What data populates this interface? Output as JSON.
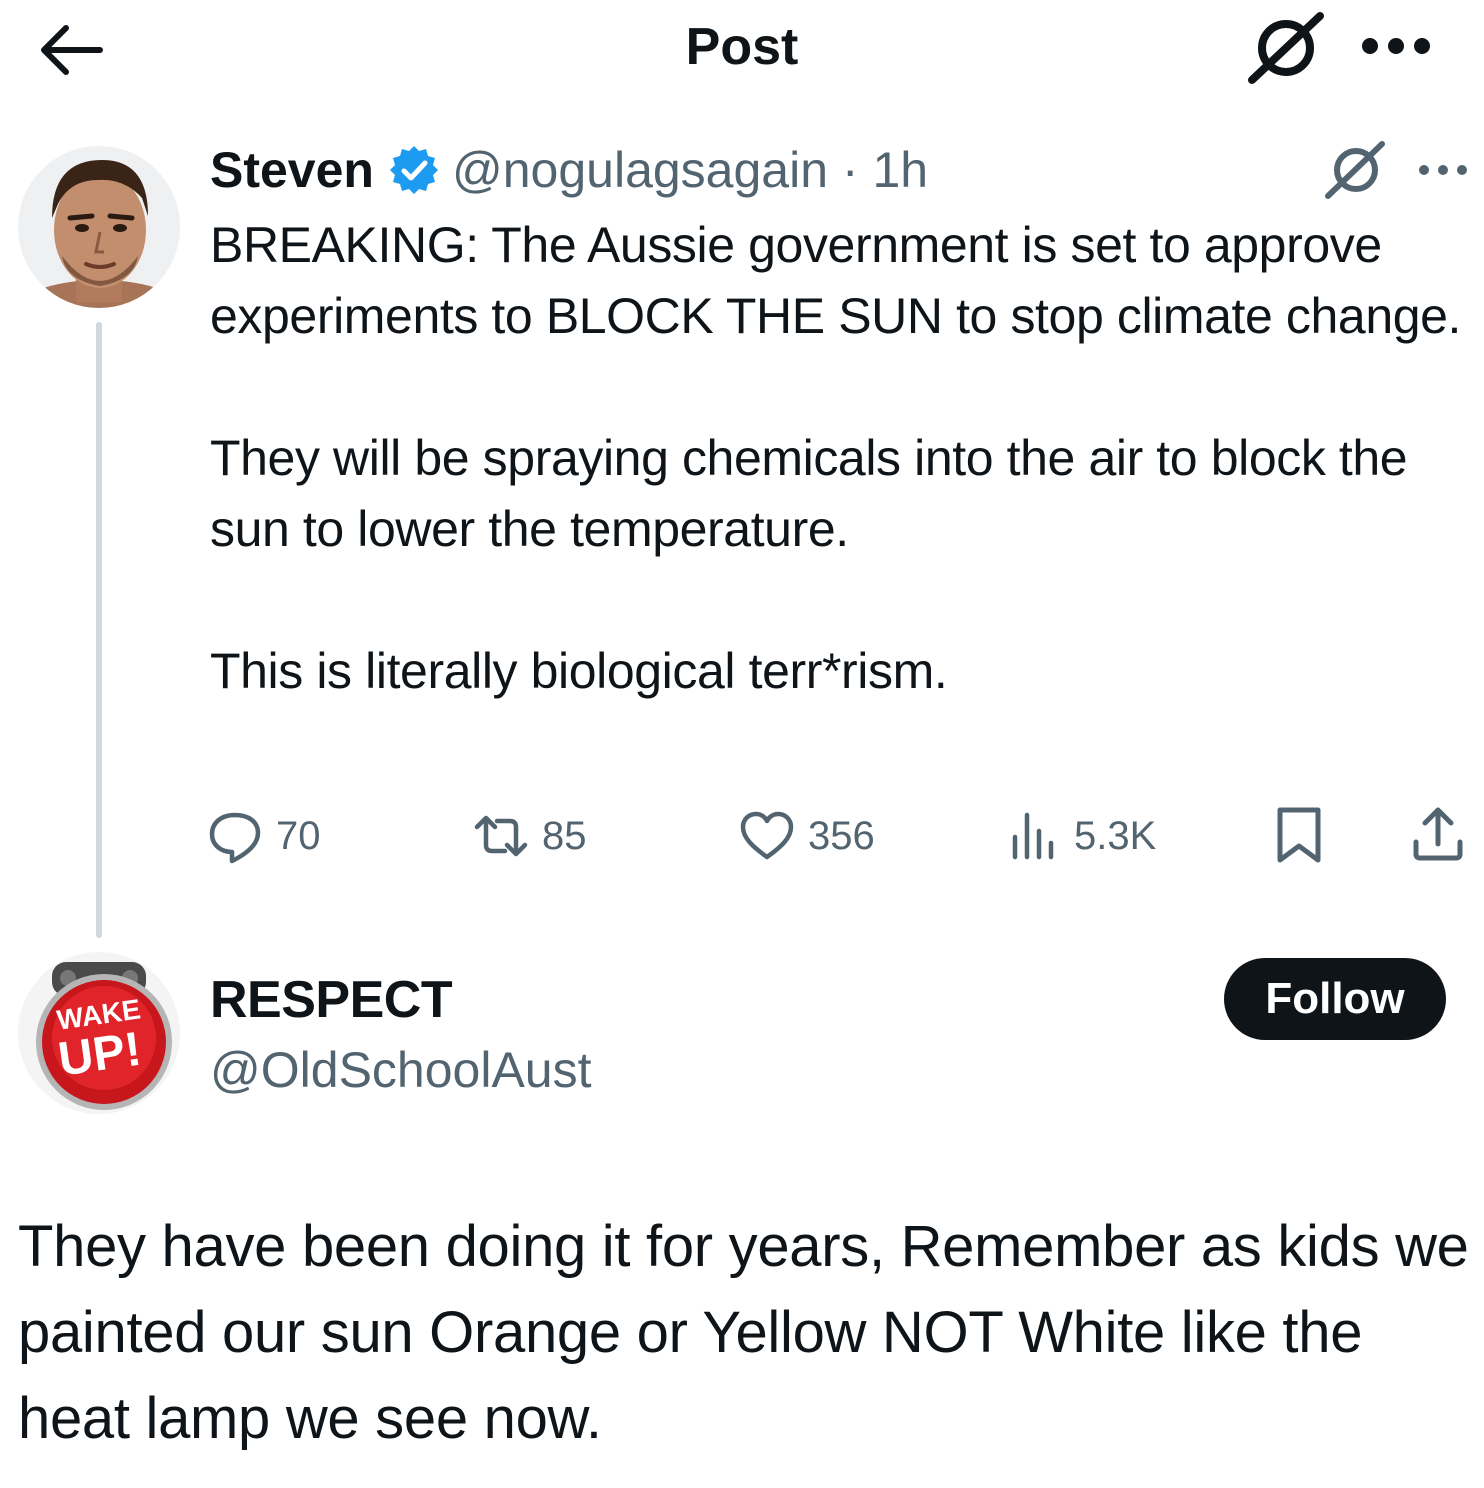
{
  "header": {
    "title": "Post",
    "back_icon": "arrow-left-icon",
    "grok_icon": "grok-icon",
    "more_icon": "more-horizontal-icon"
  },
  "tweet": {
    "author": {
      "name": "Steven",
      "verified": true,
      "verified_color": "#1d9bf0",
      "handle_meta": "@nogulagsagain · 1h"
    },
    "paragraphs": [
      "BREAKING: The Aussie government is set to approve experiments to BLOCK THE SUN to stop climate change.",
      "They will be spraying chemicals into the air to block the sun to lower the temperature.",
      "This is literally biological terr*rism."
    ],
    "actions": {
      "replies": "70",
      "reposts": "85",
      "likes": "356",
      "views": "5.3K"
    }
  },
  "reply": {
    "author": {
      "name": "RESPECT",
      "handle": "@OldSchoolAust"
    },
    "avatar_text": [
      "WAKE",
      "UP!"
    ],
    "follow_label": "Follow",
    "text": "They have been doing it for years, Remember as kids we painted our sun Orange or Yellow NOT White like the heat lamp we see now."
  },
  "colors": {
    "text": "#0f1419",
    "secondary": "#536471",
    "thread_line": "#cfd9de",
    "verified": "#1d9bf0",
    "button_bg": "#0f1419",
    "avatar_red": "#d7191f"
  }
}
